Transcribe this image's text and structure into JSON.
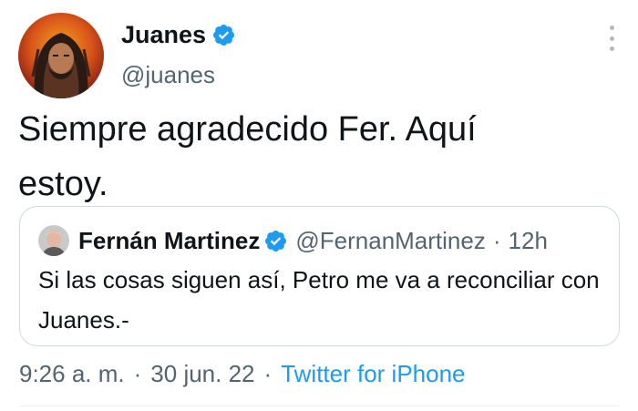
{
  "author": {
    "display_name": "Juanes",
    "handle": "@juanes",
    "verified": true
  },
  "tweet": {
    "text": "Siempre agradecido Fer. Aquí\nestoy."
  },
  "quoted_tweet": {
    "display_name": "Fernán Martinez",
    "handle": "@FernanMartinez",
    "separator": "·",
    "time": "12h",
    "text": "Si las cosas siguen así, Petro me va a reconciliar con Juanes.-"
  },
  "meta": {
    "time": "9:26 a. m.",
    "separator": "·",
    "date": "30 jun. 22",
    "source": "Twitter for iPhone"
  },
  "icons": {
    "verified": "verified-badge-icon",
    "more": "more-options-icon"
  },
  "colors": {
    "verified_blue": "#1d9bf0",
    "secondary_text": "#536471",
    "link": "#1d9bf0",
    "border": "#cfd9de"
  }
}
